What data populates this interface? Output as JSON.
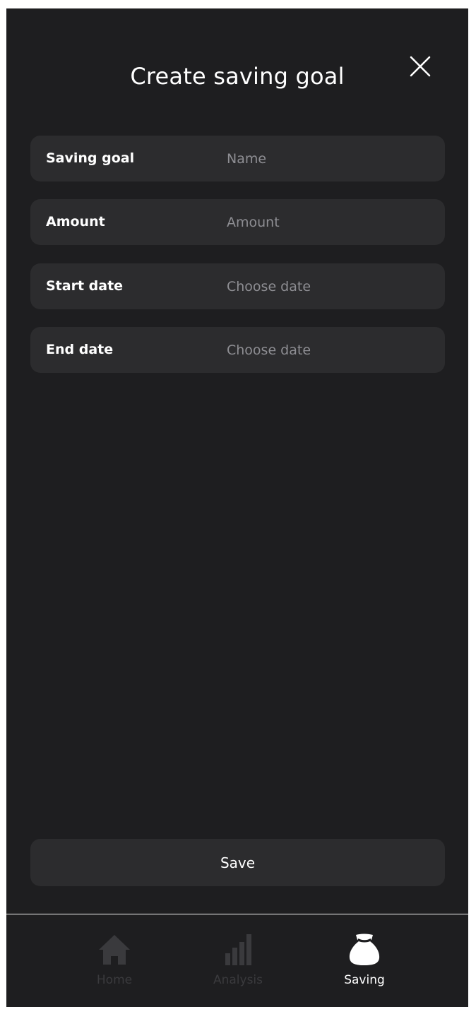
{
  "header": {
    "title": "Create saving goal"
  },
  "form": {
    "fields": [
      {
        "label": "Saving goal",
        "placeholder": "Name",
        "value": ""
      },
      {
        "label": "Amount",
        "placeholder": "Amount",
        "value": ""
      },
      {
        "label": "Start date",
        "placeholder": "Choose date",
        "value": ""
      },
      {
        "label": "End date",
        "placeholder": "Choose date",
        "value": ""
      }
    ],
    "save_label": "Save"
  },
  "nav": {
    "items": [
      {
        "label": "Home",
        "icon": "home-icon",
        "active": false
      },
      {
        "label": "Analysis",
        "icon": "bar-chart-icon",
        "active": false
      },
      {
        "label": "Saving",
        "icon": "money-bag-icon",
        "active": true
      }
    ]
  },
  "colors": {
    "background": "#1e1e20",
    "field_background": "#2c2c2e",
    "placeholder": "#8e8e93",
    "inactive_nav": "#3a3a3d",
    "active_nav": "#ffffff"
  }
}
